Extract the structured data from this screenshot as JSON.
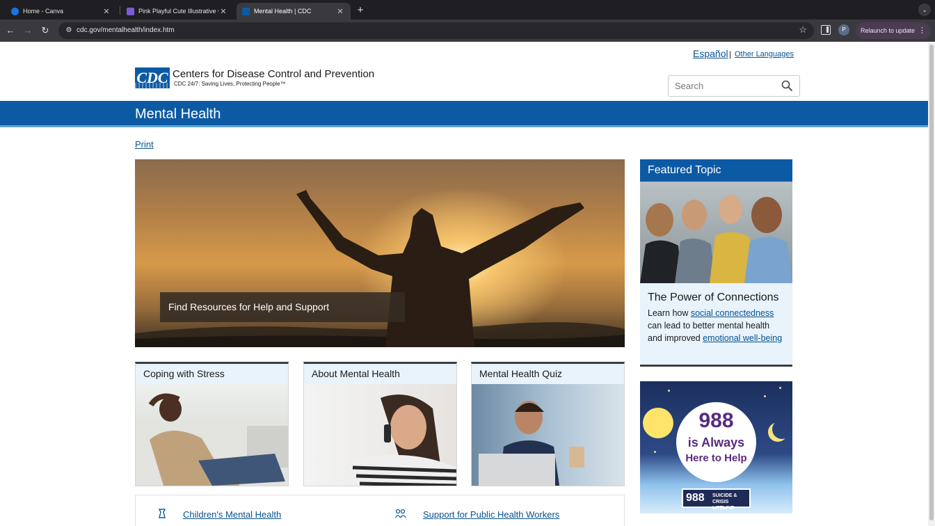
{
  "browser": {
    "tabs": [
      {
        "title": "Home - Canva",
        "active": false,
        "favicon_color": "#1a73e8"
      },
      {
        "title": "Pink Playful Cute Illustrative C",
        "active": false,
        "favicon_color": "#7b5cd6"
      },
      {
        "title": "Mental Health | CDC",
        "active": true,
        "favicon_color": "#0d5aa4"
      }
    ],
    "new_tab_label": "+",
    "tab_menu_icon": "⌄",
    "url": "cdc.gov/mentalhealth/index.htm",
    "profile_initial": "P",
    "relaunch_label": "Relaunch to update"
  },
  "page": {
    "languages": {
      "espanol": "Español",
      "separator": "|",
      "other": "Other Languages"
    },
    "logo": {
      "mark": "CDC",
      "title": "Centers for Disease Control and Prevention",
      "tagline": "CDC 24/7: Saving Lives, Protecting People™"
    },
    "search": {
      "placeholder": "Search"
    },
    "banner_title": "Mental Health",
    "print_label": "Print",
    "hero": {
      "caption": "Find Resources for Help and Support"
    },
    "cards": [
      {
        "title": "Coping with Stress"
      },
      {
        "title": "About Mental Health"
      },
      {
        "title": "Mental Health Quiz"
      }
    ],
    "featured": {
      "heading": "Featured Topic",
      "subtitle": "The Power of Connections",
      "text_1": "Learn how ",
      "link_1": "social connectedness",
      "text_2": " can lead to better mental health and improved ",
      "link_2": "emotional well-being"
    },
    "ad988": {
      "number": "988",
      "line2": "is Always",
      "line3": "Here to Help",
      "badge_number": "988",
      "badge_text_1": "SUICIDE & CRISIS",
      "badge_text_2": "LIFELINE"
    },
    "links": [
      {
        "label": "Children's Mental Health",
        "icon": "child-icon"
      },
      {
        "label": "Support for Public Health Workers",
        "icon": "people-icon"
      }
    ]
  },
  "colors": {
    "cdc_blue": "#0d5aa4",
    "link_blue": "#075290",
    "card_header_bg": "#e8f3fb",
    "chrome_dark": "#1f1f23"
  }
}
